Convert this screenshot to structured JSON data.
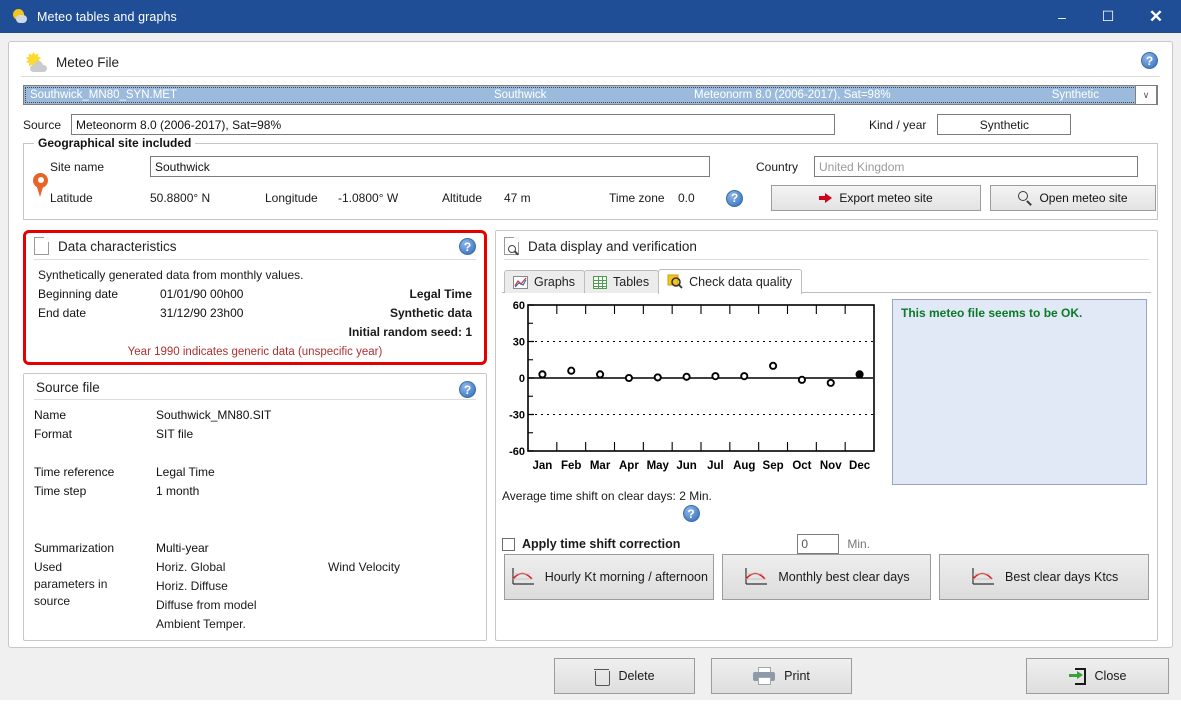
{
  "window": {
    "title": "Meteo tables and graphs",
    "minimize": "–",
    "maximize": "☐",
    "close": "✕"
  },
  "meteo_file": {
    "section_title": "Meteo File",
    "help": "?",
    "filebar": {
      "filename": "Southwick_MN80_SYN.MET",
      "site": "Southwick",
      "source": "Meteonorm 8.0 (2006-2017), Sat=98%",
      "kind": "Synthetic",
      "chevron": "∨"
    },
    "source_label": "Source",
    "source_value": "Meteonorm 8.0 (2006-2017), Sat=98%",
    "kind_year_label": "Kind / year",
    "kind_year_value": "Synthetic"
  },
  "geo": {
    "group_label": "Geographical site included",
    "site_name_label": "Site name",
    "site_name_value": "Southwick",
    "latitude_label": "Latitude",
    "latitude_value": "50.8800° N",
    "longitude_label": "Longitude",
    "longitude_value": "-1.0800° W",
    "altitude_label": "Altitude",
    "altitude_value": "47 m",
    "timezone_label": "Time zone",
    "timezone_value": "0.0",
    "help": "?",
    "country_label": "Country",
    "country_placeholder": "United Kingdom",
    "export_button": "Export meteo site",
    "open_button": "Open meteo site"
  },
  "data_characteristics": {
    "section_title": "Data characteristics",
    "help": "?",
    "intro": "Synthetically generated data from monthly values.",
    "beginning_label": "Beginning date",
    "beginning_value": "01/01/90 00h00",
    "beginning_right": "Legal Time",
    "end_label": "End date",
    "end_value": "31/12/90 23h00",
    "end_right": "Synthetic data",
    "seed_right": "Initial random seed: 1",
    "note": "Year 1990 indicates generic data (unspecific year)",
    "highlight_color": "#e50000"
  },
  "source_file": {
    "section_title": "Source file",
    "help": "?",
    "rows": [
      {
        "k": "Name",
        "v": "Southwick_MN80.SIT"
      },
      {
        "k": "Format",
        "v": "SIT file"
      },
      {
        "k": "Time reference",
        "v": "Legal Time"
      },
      {
        "k": "Time step",
        "v": "1 month"
      },
      {
        "k": "Summarization",
        "v": "Multi-year"
      }
    ],
    "used_params_label_line1": "Used",
    "used_params_label_line2": "parameters in",
    "used_params_label_line3": "source",
    "used_params": [
      "Horiz. Global",
      "Horiz. Diffuse",
      "Diffuse from model",
      "Ambient Temper."
    ],
    "used_params_right": "Wind Velocity"
  },
  "data_display": {
    "section_title": "Data display and verification",
    "tabs": [
      {
        "label": "Graphs",
        "icon": "graphs-icon",
        "active": false
      },
      {
        "label": "Tables",
        "icon": "tables-icon",
        "active": false
      },
      {
        "label": "Check data quality",
        "icon": "check-data-quality-icon",
        "active": true
      }
    ],
    "message": "This meteo file seems to be OK.",
    "message_color": "#0a7a28",
    "average_shift_note": "Average time shift on clear days: 2 Min.",
    "help": "?",
    "apply_correction_label": "Apply time shift correction",
    "apply_correction_checked": false,
    "correction_value": "0",
    "correction_unit": "Min.",
    "action_buttons": [
      "Hourly Kt morning / afternoon",
      "Monthly best clear days",
      "Best clear days Ktcs"
    ]
  },
  "chart_data": {
    "type": "scatter",
    "title": "",
    "xlabel": "",
    "ylabel": "",
    "categories": [
      "Jan",
      "Feb",
      "Mar",
      "Apr",
      "May",
      "Jun",
      "Jul",
      "Aug",
      "Sep",
      "Oct",
      "Nov",
      "Dec"
    ],
    "values": [
      3,
      6,
      3,
      0,
      0.5,
      1,
      1.5,
      1.5,
      10,
      -1.5,
      -4,
      3
    ],
    "ylim": [
      -60,
      60
    ],
    "yticks": [
      -60,
      -30,
      0,
      30,
      60
    ],
    "ytick_labels": [
      "-60",
      "-30",
      "0",
      "30",
      "60"
    ],
    "grid": "dotted horizontal at -30 and 30; solid zero line",
    "legend": "none",
    "marker": "open circle (Dec filled)",
    "annotation": "Average time shift on clear days: 2 Min."
  },
  "footer": {
    "delete": "Delete",
    "print": "Print",
    "close": "Close"
  }
}
